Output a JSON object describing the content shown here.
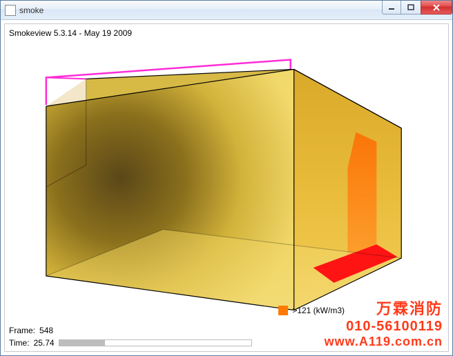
{
  "window": {
    "title": "smoke"
  },
  "app": {
    "version_line": "Smokeview 5.3.14 - May 19 2009"
  },
  "status": {
    "frame_label": "Frame:",
    "frame_value": "548",
    "time_label": "Time:",
    "time_value": "25.74",
    "progress_percent": 24
  },
  "legend": {
    "color": "#ff7a00",
    "label": ">121 (kW/m3)"
  },
  "watermark": {
    "line1": "万霖消防",
    "line2": "010-56100119",
    "line3": "www.A119.com.cn"
  }
}
